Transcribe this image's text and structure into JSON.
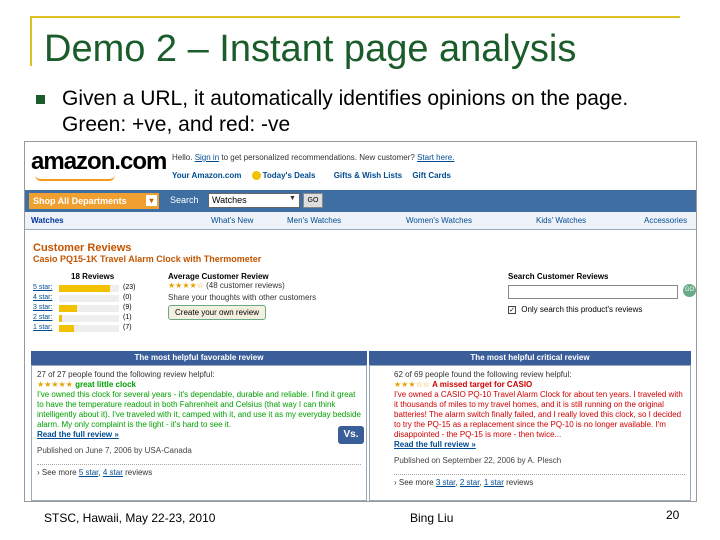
{
  "slide": {
    "title": "Demo 2 – Instant page analysis",
    "bullet": "Given a URL, it automatically identifies opinions on the page. Green: +ve, and red: -ve",
    "footer_left": "STSC, Hawaii, May 22-23, 2010",
    "footer_mid": "Bing Liu",
    "page_number": "20",
    "accent_color": "#1a5c2a",
    "frame_color": "#e0c020"
  },
  "amazon": {
    "logo": "amazon.com",
    "hello_prefix": "Hello.",
    "sign_in": "Sign in",
    "hello_suffix": "to get personalized recommendations. New customer?",
    "start_here": "Start here.",
    "top_links": [
      "Your Amazon.com",
      "Today's Deals",
      "Gifts & Wish Lists",
      "Gift Cards"
    ],
    "shop_all": "Shop All Departments",
    "search_label": "Search",
    "search_value": "Watches",
    "go_label": "GO",
    "tabs": [
      "Watches",
      "What's New",
      "Men's Watches",
      "Women's Watches",
      "Kids' Watches",
      "Accessories"
    ],
    "reviews_heading": "Customer Reviews",
    "product": "Casio PQ15-1K Travel Alarm Clock with Thermometer",
    "review_count": "18 Reviews",
    "histogram": [
      {
        "label": "5 star:",
        "count": "(23)",
        "fraction": 0.85
      },
      {
        "label": "4 star:",
        "count": "(0)",
        "fraction": 0.0
      },
      {
        "label": "3 star:",
        "count": "(9)",
        "fraction": 0.3
      },
      {
        "label": "2 star:",
        "count": "(1)",
        "fraction": 0.05
      },
      {
        "label": "1 star:",
        "count": "(7)",
        "fraction": 0.25
      }
    ],
    "avg_heading": "Average Customer Review",
    "avg_stars": "★★★★☆",
    "avg_count": "(48 customer reviews)",
    "share_text": "Share your thoughts with other customers",
    "own_review": "Create your own review",
    "search_reviews_heading": "Search Customer Reviews",
    "only_this_product": "Only search this product's reviews",
    "search_go": "GO",
    "favorable_heading": "The most helpful favorable review",
    "critical_heading": "The most helpful critical review",
    "vs": "Vs.",
    "favorable": {
      "helpful": "27 of 27 people found the following review helpful:",
      "stars": "★★★★★",
      "title": "great little clock",
      "text": "I've owned this clock for several years - it's dependable, durable and reliable. I find it great to have the temperature readout in both Fahrenheit and Celsius (that way I can think intelligently about it). I've traveled with it, camped with it, and use it as my everyday bedside alarm. My only complaint is the light - it's hard to see it.",
      "read_more": "Read the full review »",
      "published": "Published on June 7, 2006 by USA-Canada",
      "see_more_prefix": "› See more",
      "see_more_links": [
        "5 star",
        "4 star"
      ],
      "see_more_suffix": "reviews"
    },
    "critical": {
      "helpful": "62 of 69 people found the following review helpful:",
      "stars": "★★★☆☆",
      "title": "A missed target for CASIO",
      "text": "I've owned a CASIO PQ-10 Travel Alarm Clock for about ten years. I traveled with it thousands of miles to my travel homes, and it is still running on the original batteries! The alarm switch finally failed, and I really loved this clock, so I decided to try the PQ-15 as a replacement since the PQ-10 is no longer available. I'm disappointed - the PQ-15 is more - then twice...",
      "read_more": "Read the full review »",
      "published": "Published on September 22, 2006 by A. Plesch",
      "see_more_prefix": "› See more",
      "see_more_links": [
        "3 star",
        "2 star",
        "1 star"
      ],
      "see_more_suffix": "reviews"
    }
  }
}
